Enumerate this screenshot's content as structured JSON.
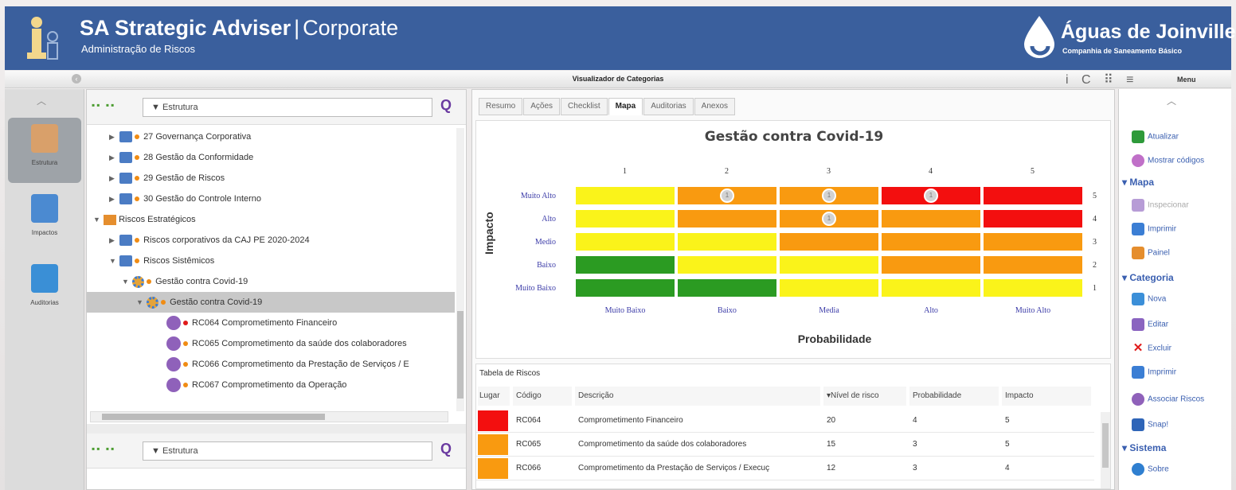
{
  "header": {
    "title": "SA Strategic Adviser",
    "separator": "|",
    "title_suffix": "Corporate",
    "subtitle": "Administração de Riscos",
    "brand_name": "Águas de Joinville",
    "brand_subtitle": "Companhia de Saneamento Básico"
  },
  "toolbar_bar": {
    "title": "Visualizador de Categorias",
    "menu_label": "Menu",
    "icons": "i C ⠿ ≡"
  },
  "left_nav": {
    "items": [
      {
        "label": "Estrutura"
      },
      {
        "label": "Impactos"
      },
      {
        "label": "Auditorias"
      }
    ]
  },
  "tree_top": {
    "select_value": "Estrutura"
  },
  "tree_bottom": {
    "select_value": "Estrutura"
  },
  "tree": [
    {
      "label": "27 Governança Corporativa"
    },
    {
      "label": "28 Gestão da Conformidade"
    },
    {
      "label": "29 Gestão de Riscos"
    },
    {
      "label": "30 Gestão do Controle Interno"
    },
    {
      "label": "Riscos Estratégicos"
    },
    {
      "label": "Riscos corporativos da CAJ PE 2020-2024"
    },
    {
      "label": "Riscos Sistêmicos"
    },
    {
      "label": "Gestão contra Covid-19"
    },
    {
      "label": "Gestão contra Covid-19"
    },
    {
      "label": "RC064 Comprometimento Financeiro"
    },
    {
      "label": "RC065 Comprometimento da saúde dos colaboradores"
    },
    {
      "label": "RC066 Comprometimento da Prestação de Serviços / E"
    },
    {
      "label": "RC067 Comprometimento da Operação"
    }
  ],
  "tabs": [
    "Resumo",
    "Ações",
    "Checklist",
    "Mapa",
    "Auditorias",
    "Anexos"
  ],
  "chart_data": {
    "type": "heatmap",
    "title": "Gestão contra Covid-19",
    "xlabel": "Probabilidade",
    "ylabel": "Impacto",
    "x_categories": [
      "Muito Baixo",
      "Baixo",
      "Media",
      "Alto",
      "Muito Alto"
    ],
    "x_numbers": [
      "1",
      "2",
      "3",
      "4",
      "5"
    ],
    "y_categories": [
      "Muito Alto",
      "Alto",
      "Medio",
      "Baixo",
      "Muito Baixo"
    ],
    "y_numbers": [
      "5",
      "4",
      "3",
      "2",
      "1"
    ],
    "colors": [
      [
        "y",
        "o",
        "o",
        "r",
        "r"
      ],
      [
        "y",
        "o",
        "o",
        "o",
        "r"
      ],
      [
        "y",
        "y",
        "o",
        "o",
        "o"
      ],
      [
        "g",
        "y",
        "y",
        "o",
        "o"
      ],
      [
        "g",
        "g",
        "y",
        "y",
        "y"
      ]
    ],
    "bubbles": [
      {
        "row": 0,
        "col": 1,
        "label": "1"
      },
      {
        "row": 0,
        "col": 2,
        "label": "1"
      },
      {
        "row": 0,
        "col": 3,
        "label": "1"
      },
      {
        "row": 1,
        "col": 2,
        "label": "1"
      }
    ],
    "palette": {
      "g": "#2b9b22",
      "y": "#faf31a",
      "o": "#f99a10",
      "r": "#f30f0f"
    }
  },
  "table": {
    "title": "Tabela de Riscos",
    "headers": [
      "Lugar",
      "Código",
      "Descrição",
      "Nível de risco",
      "Probabilidade",
      "Impacto"
    ],
    "rows": [
      {
        "color": "#f30f0f",
        "code": "RC064",
        "desc": "Comprometimento Financeiro",
        "nivel": "20",
        "prob": "4",
        "imp": "5"
      },
      {
        "color": "#f99a10",
        "code": "RC065",
        "desc": "Comprometimento da saúde dos colaboradores",
        "nivel": "15",
        "prob": "3",
        "imp": "5"
      },
      {
        "color": "#f99a10",
        "code": "RC066",
        "desc": "Comprometimento da Prestação de Serviços / Execuç",
        "nivel": "12",
        "prob": "3",
        "imp": "4"
      }
    ]
  },
  "right_menu": {
    "items": [
      {
        "label": "Atualizar"
      },
      {
        "label": "Mostrar códigos"
      },
      {
        "section": "Mapa"
      },
      {
        "label": "Inspecionar"
      },
      {
        "label": "Imprimir"
      },
      {
        "label": "Painel"
      },
      {
        "section": "Categoria"
      },
      {
        "label": "Nova"
      },
      {
        "label": "Editar"
      },
      {
        "label": "Excluir"
      },
      {
        "label": "Imprimir"
      },
      {
        "label": "Associar Riscos"
      },
      {
        "label": "Snap!"
      },
      {
        "section": "Sistema"
      },
      {
        "label": "Sobre"
      }
    ]
  }
}
